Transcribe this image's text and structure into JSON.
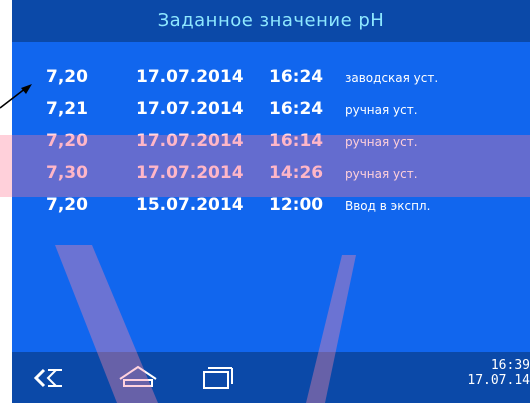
{
  "header": {
    "title": "Заданное значение pH"
  },
  "history": [
    {
      "value": "7,20",
      "date": "17.07.2014",
      "time": "16:24",
      "description": "заводская уст."
    },
    {
      "value": "7,21",
      "date": "17.07.2014",
      "time": "16:24",
      "description": "ручная уст."
    },
    {
      "value": "7,20",
      "date": "17.07.2014",
      "time": "16:14",
      "description": "ручная уст."
    },
    {
      "value": "7,30",
      "date": "17.07.2014",
      "time": "14:26",
      "description": "ручная уст."
    },
    {
      "value": "7,20",
      "date": "15.07.2014",
      "time": "12:00",
      "description": "Ввод в экспл."
    }
  ],
  "statusbar": {
    "time": "16:39",
    "date": "17.07.14"
  },
  "icons": {
    "back": "back-icon",
    "home": "home-icon",
    "recents": "recent-apps-icon",
    "pointer": "arrow-pointer-icon"
  },
  "colors": {
    "screen": "#1166ee",
    "bars": "#0b49a8",
    "title": "#8ee8ff"
  }
}
